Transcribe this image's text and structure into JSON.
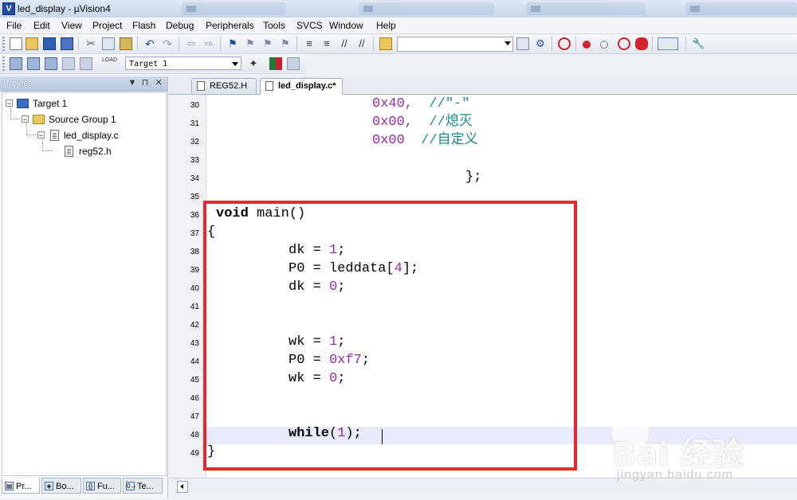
{
  "window": {
    "title": "led_display - µVision4",
    "app_icon_letter": "V"
  },
  "menubar": {
    "items": [
      "File",
      "Edit",
      "View",
      "Project",
      "Flash",
      "Debug",
      "Peripherals",
      "Tools",
      "SVCS",
      "Window",
      "Help"
    ]
  },
  "toolbar2": {
    "target_combo": "Target 1",
    "load_label": "LOAD"
  },
  "project_panel": {
    "title": "Project",
    "pin_glyph": "▼",
    "dock_glyph": "⊓",
    "close_glyph": "✕",
    "tree": {
      "target": "Target 1",
      "group": "Source Group 1",
      "file": "led_display.c",
      "header": "reg52.h"
    },
    "bottom_tabs": [
      {
        "label": "Pr...",
        "glyph": "▤"
      },
      {
        "label": "Bo...",
        "glyph": "◈"
      },
      {
        "label": "Fu...",
        "glyph": "{}"
      },
      {
        "label": "Te...",
        "glyph": "0→"
      }
    ]
  },
  "editor": {
    "tabs": [
      {
        "label": "REG52.H",
        "active": false
      },
      {
        "label": "led_display.c*",
        "active": true
      }
    ],
    "line_numbers": [
      "30",
      "31",
      "32",
      "33",
      "34",
      "35",
      "36",
      "37",
      "38",
      "39",
      "40",
      "41",
      "42",
      "43",
      "44",
      "45",
      "46",
      "47",
      "48",
      "49"
    ],
    "lines": {
      "l30_num": "0x40,",
      "l30_cmt": "//\"-\"",
      "l31_num": "0x00,",
      "l31_cmt": "//熄灭",
      "l32_num": "0x00",
      "l32_cmt": "//自定义",
      "l34": "};",
      "l36_kw": "void",
      "l36_rest": " main()",
      "l37": "{",
      "l38_a": "dk = ",
      "l38_n": "1",
      "l38_b": ";",
      "l39_a": "P0 = leddata[",
      "l39_n": "4",
      "l39_b": "];",
      "l40_a": "dk = ",
      "l40_n": "0",
      "l40_b": ";",
      "l43_a": "wk = ",
      "l43_n": "1",
      "l43_b": ";",
      "l44_a": "P0 = ",
      "l44_n": "0xf7",
      "l44_b": ";",
      "l45_a": "wk = ",
      "l45_n": "0",
      "l45_b": ";",
      "l48_kw": "while",
      "l48_p1": "(",
      "l48_n": "1",
      "l48_p2": ");",
      "l49": "}"
    }
  },
  "colors": {
    "highlight_box": "#e8262d",
    "number": "#9b2aa8",
    "comment": "#1a8a8a"
  },
  "watermark": {
    "logo": "Bai  经验",
    "url": "jingyan.baidu.com"
  }
}
